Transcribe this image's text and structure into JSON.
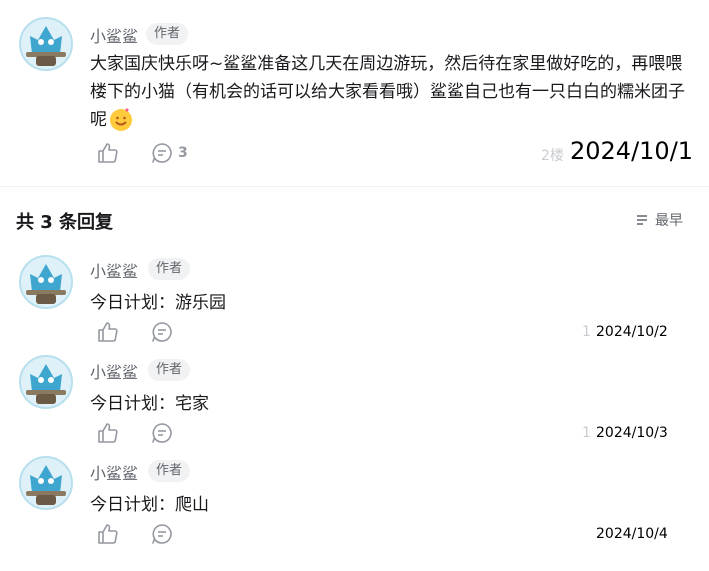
{
  "main_comment": {
    "username": "小鲨鲨",
    "author_badge": "作者",
    "text": "大家国庆快乐呀~鲨鲨准备这几天在周边游玩，然后待在家里做好吃的，再喂喂楼下的小猫（有机会的话可以给大家看看哦）鲨鲨自己也有一只白白的糯米团子呢",
    "reply_count": "3",
    "floor": "2楼",
    "date": "2024/10/1"
  },
  "replies_header": {
    "title": "共 3 条回复",
    "sort_label": "最早"
  },
  "replies": [
    {
      "username": "小鲨鲨",
      "badge": "作者",
      "text": "今日计划：游乐园",
      "ghost": "1",
      "date": "2024/10/2"
    },
    {
      "username": "小鲨鲨",
      "badge": "作者",
      "text": "今日计划：宅家",
      "ghost": "1",
      "date": "2024/10/3"
    },
    {
      "username": "小鲨鲨",
      "badge": "作者",
      "text": "今日计划：爬山",
      "ghost": "",
      "date": "2024/10/4"
    }
  ],
  "colors": {
    "avatar_bg": "#cfeaf3",
    "shark": "#3ea6cf",
    "sword": "#8a7a62"
  }
}
